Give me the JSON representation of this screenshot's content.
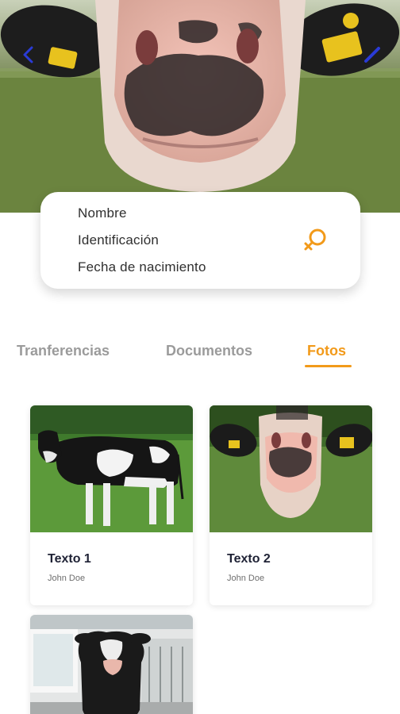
{
  "header": {
    "back_icon": "chevron-left-icon",
    "edit_icon": "pencil-icon",
    "accent_color": "#2a3bd6"
  },
  "info": {
    "name_label": "Nombre",
    "id_label": "Identificación",
    "birth_label": "Fecha de nacimiento",
    "gender_icon": "female-symbol-icon",
    "gender_color": "#f29a1a"
  },
  "tabs": [
    {
      "label": "Tranferencias",
      "active": false
    },
    {
      "label": "Documentos",
      "active": false
    },
    {
      "label": "Fotos",
      "active": true
    }
  ],
  "active_color": "#f29a1a",
  "photos": [
    {
      "title": "Texto 1",
      "author": "John Doe",
      "image": "cow-standing-in-field"
    },
    {
      "title": "Texto 2",
      "author": "John Doe",
      "image": "cow-face-closeup"
    },
    {
      "title": "",
      "author": "",
      "image": "cow-in-barn"
    }
  ]
}
